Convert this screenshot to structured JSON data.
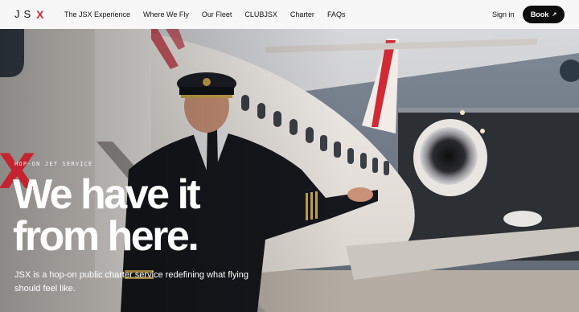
{
  "brand": {
    "logo_text": "JS",
    "logo_mark": "X",
    "accent": "#d42a36"
  },
  "nav": {
    "links": [
      "The JSX Experience",
      "Where We Fly",
      "Our Fleet",
      "CLUBJSX",
      "Charter",
      "FAQs"
    ],
    "signin": "Sign in",
    "book": "Book",
    "book_icon": "arrow-up-right-icon"
  },
  "hero": {
    "eyebrow": "HOP-ON JET SERVICE",
    "headline_line1": "We have it",
    "headline_line2": "from here.",
    "subtext": "JSX is a hop-on public charter service redefining what flying should feel like.",
    "image": "pilot-by-jet-photo"
  }
}
